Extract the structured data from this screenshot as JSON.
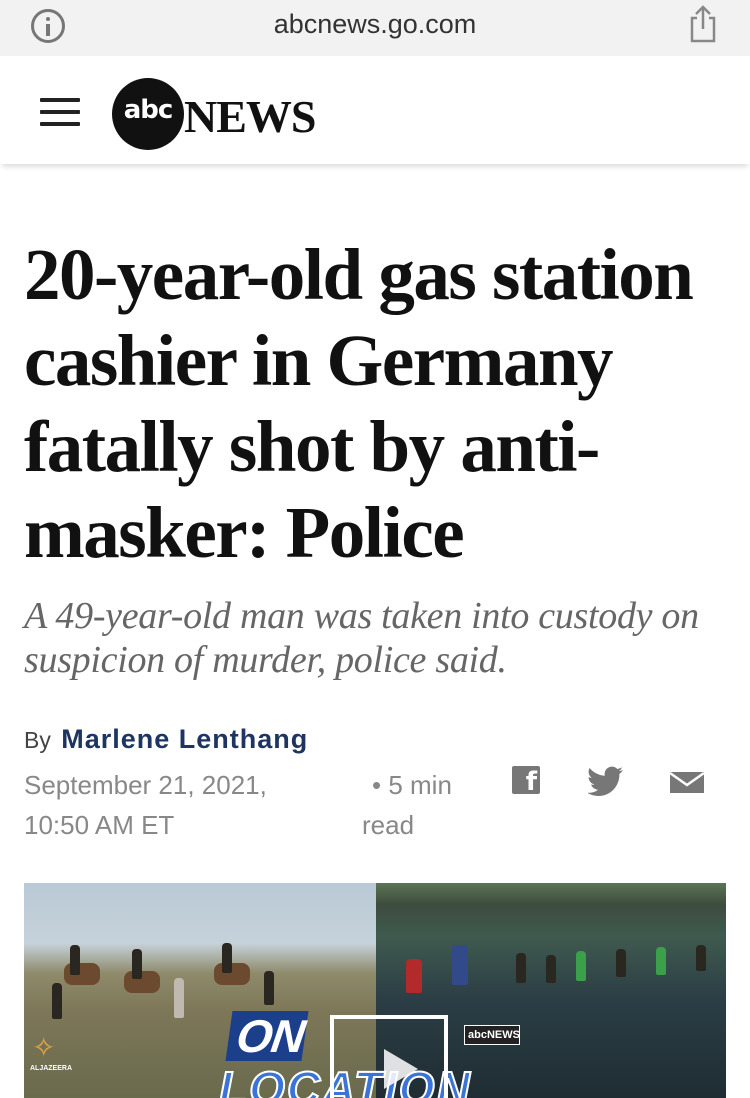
{
  "browser": {
    "url": "abcnews.go.com",
    "info_icon": "info-icon",
    "share_icon": "share-icon"
  },
  "header": {
    "menu_icon": "hamburger-menu-icon",
    "logo_abc": "abc",
    "logo_news": "NEWS"
  },
  "article": {
    "headline": "20-year-old gas station cashier in Germany fatally shot by anti-masker: Police",
    "subheadline": "A 49-year-old man was taken into custody on suspicion of murder, police said.",
    "byline_prefix": "By",
    "author": "Marlene Lenthang",
    "date_line1": "September 21, 2021,",
    "date_line2": "10:50 AM ET",
    "read_time_line1": "5 min",
    "read_time_line2": "read",
    "bullet": "•",
    "share_icons": [
      "facebook-icon",
      "twitter-icon",
      "email-icon"
    ]
  },
  "video": {
    "overlay_on": "ON",
    "overlay_location": "LOCATION",
    "mini_logo": "abcNEWS",
    "corner_logo_text": "ALJAZEERA"
  },
  "colors": {
    "author": "#1e3561",
    "headline": "#111111",
    "subhead": "#666666",
    "meta": "#888888",
    "browser_bar": "#f2f2f2"
  }
}
